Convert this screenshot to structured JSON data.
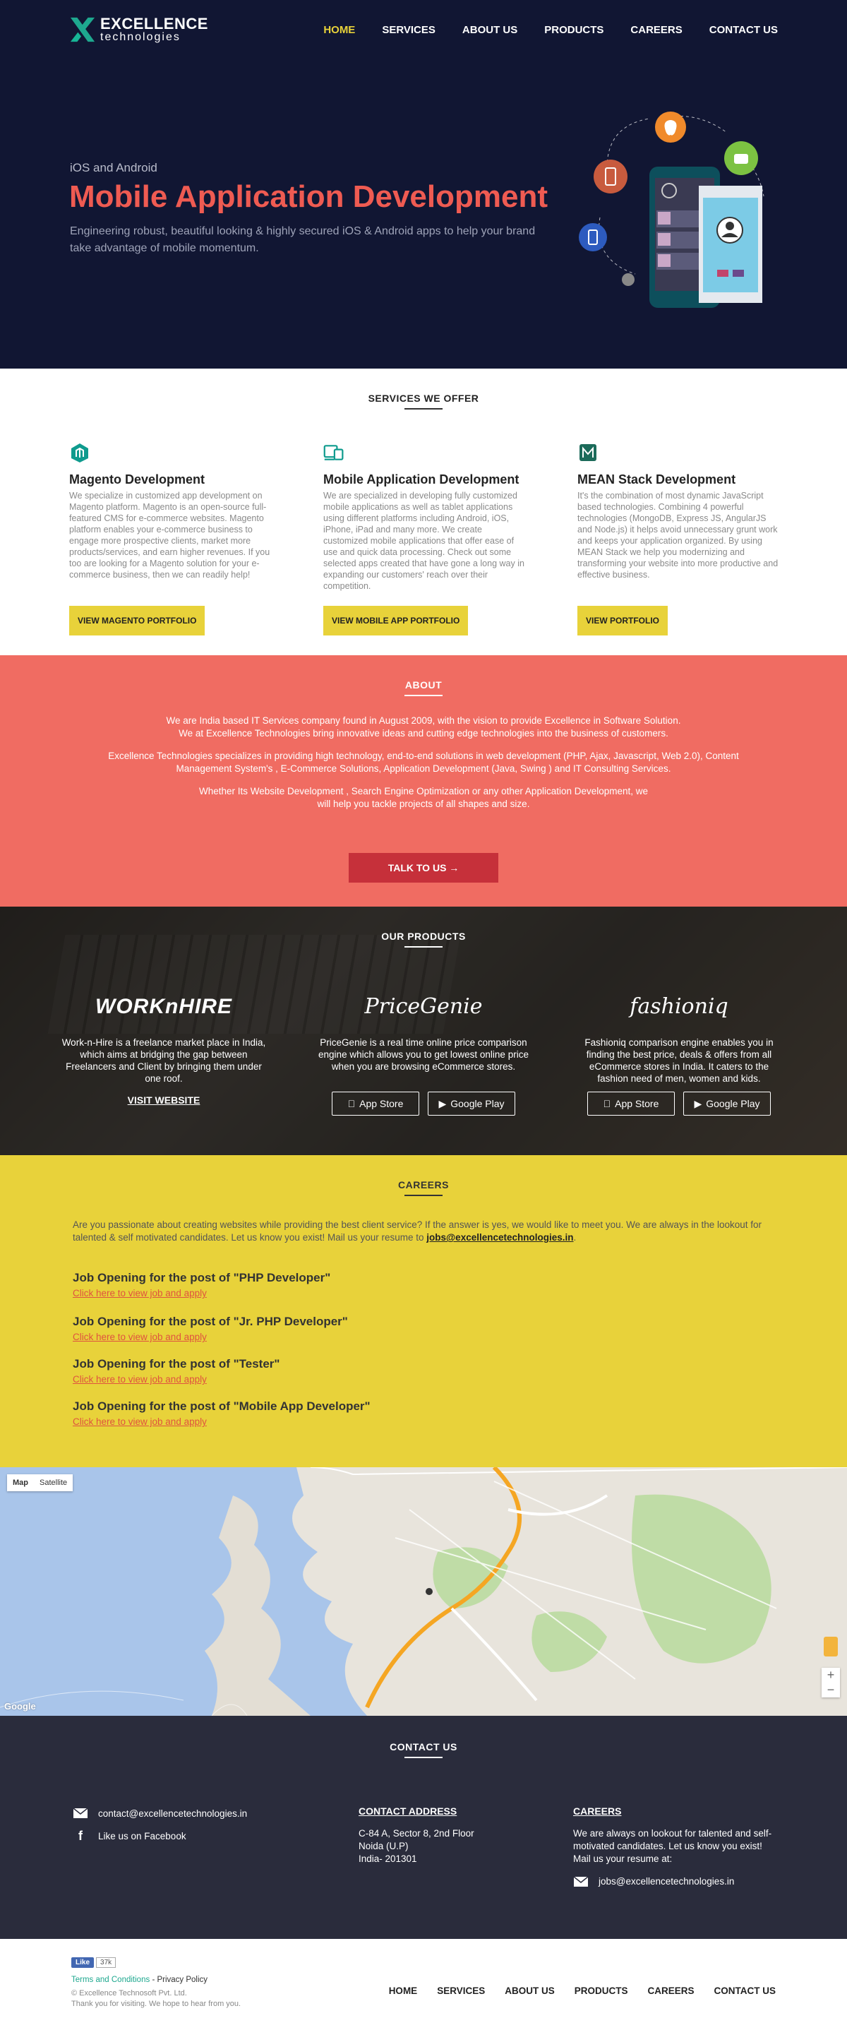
{
  "brand": {
    "line1": "EXCELLENCE",
    "line2": "technologies"
  },
  "nav": {
    "items": [
      "HOME",
      "SERVICES",
      "ABOUT US",
      "PRODUCTS",
      "CAREERS",
      "CONTACT US"
    ],
    "active": "HOME"
  },
  "hero": {
    "kicker": "iOS and Android",
    "title": "Mobile Application Development",
    "text": "Engineering robust, beautiful looking & highly secured iOS & Android apps to help your brand take advantage of mobile momentum."
  },
  "services": {
    "title": "SERVICES WE OFFER",
    "items": [
      {
        "icon": "magento-icon",
        "title": "Magento Development",
        "text": "We specialize in customized app development on Magento platform. Magento is an open-source full-featured CMS for e-commerce websites. Magento platform enables your e-commerce business to engage more prospective clients, market more products/services, and earn higher revenues. If you too are looking for a Magento solution for your e-commerce business, then we can readily help!",
        "button": "VIEW MAGENTO PORTFOLIO"
      },
      {
        "icon": "mobile-devices-icon",
        "title": "Mobile Application Development",
        "text": "We are specialized in developing fully customized mobile applications as well as tablet applications using different platforms including Android, iOS, iPhone, iPad and many more. We create customized mobile applications that offer ease of use and quick data processing. Check out some selected apps created that have gone a long way in expanding our customers' reach over their competition.",
        "button": "VIEW MOBILE APP PORTFOLIO"
      },
      {
        "icon": "mean-stack-icon",
        "title": "MEAN Stack Development",
        "text": "It's the combination of most dynamic JavaScript based technologies. Combining 4 powerful technologies (MongoDB, Express JS, AngularJS and Node.js) it helps avoid unnecessary grunt work and keeps your application organized. By using MEAN Stack we help you modernizing and transforming your website into more productive and effective business.",
        "button": "VIEW PORTFOLIO"
      }
    ]
  },
  "about": {
    "title": "ABOUT",
    "p1": "We are India based IT Services company found in August 2009, with the vision to provide Excellence in Software Solution.",
    "p2": "We at Excellence Technologies bring innovative ideas and cutting edge technologies into the business of customers.",
    "p3": "Excellence Technologies specializes in providing high technology, end-to-end solutions in web development (PHP, Ajax, Javascript, Web 2.0), Content Management System's , E-Commerce Solutions, Application Development (Java, Swing ) and IT Consulting Services.",
    "p4": "Whether Its Website Development , Search Engine Optimization or any other Application Development, we will help you tackle projects of all shapes and size.",
    "button": "TALK TO US"
  },
  "products": {
    "title": "OUR PRODUCTS",
    "items": [
      {
        "logo": "WORKnHIRE",
        "text": "Work-n-Hire is a freelance market place in India, which aims at bridging the gap between Freelancers and Client by bringing them under one roof.",
        "link": "VISIT WEBSITE"
      },
      {
        "logo": "PriceGenie",
        "text": "PriceGenie is a real time online price comparison engine which allows you to get lowest online price when you are browsing eCommerce stores.",
        "store1": "App Store",
        "store2": "Google Play"
      },
      {
        "logo": "fashioniq",
        "text": "Fashioniq comparison engine enables you in finding the best price, deals & offers from all eCommerce stores in India. It caters to the fashion need of men, women and kids.",
        "store1": "App Store",
        "store2": "Google Play"
      }
    ]
  },
  "careers": {
    "title": "CAREERS",
    "intro": "Are you passionate about creating websites while providing the best client service? If the answer is yes, we would like to meet you. We are always in the lookout for talented & self motivated candidates. Let us know you exist! Mail us your resume to ",
    "email": "jobs@excellencetechnologies.in",
    "jobs": [
      {
        "title": "Job Opening for the post of \"PHP Developer\"",
        "link": "Click here to view job and apply"
      },
      {
        "title": "Job Opening for the post of \"Jr. PHP Developer\"",
        "link": "Click here to view job and apply"
      },
      {
        "title": "Job Opening for the post of \"Tester\"",
        "link": "Click here to view job and apply"
      },
      {
        "title": "Job Opening for the post of \"Mobile App Developer\"",
        "link": "Click here to view job and apply"
      }
    ]
  },
  "map": {
    "map_label": "Map",
    "satellite_label": "Satellite",
    "zoom_in": "+",
    "zoom_out": "−",
    "google": "Google"
  },
  "contact": {
    "title": "CONTACT US",
    "email": "contact@excellencetechnologies.in",
    "facebook": "Like us on Facebook",
    "address_title": "CONTACT ADDRESS",
    "address1": "C-84 A, Sector 8, 2nd Floor",
    "address2": "Noida (U.P)",
    "address3": "India- 201301",
    "careers_title": "CAREERS",
    "careers_text": "We are always on lookout for talented and self-motivated candidates. Let us know you exist! Mail us your resume at:",
    "careers_email": "jobs@excellencetechnologies.in"
  },
  "footer": {
    "fb_like": "Like",
    "fb_count": "37k",
    "terms": "Terms and Conditions",
    "privacy": "- Privacy Policy",
    "copyright": "© Excellence Technosoft Pvt. Ltd.",
    "thanks": "Thank you for visiting. We hope to hear from you.",
    "menu": [
      "HOME",
      "SERVICES",
      "ABOUT US",
      "PRODUCTS",
      "CAREERS",
      "CONTACT US"
    ]
  },
  "colors": {
    "navy": "#111633",
    "accent_red": "#ef5b52",
    "coral": "#f06c62",
    "yellow": "#e8d23a",
    "teal": "#1ea88f",
    "dark": "#2a2c3c"
  }
}
